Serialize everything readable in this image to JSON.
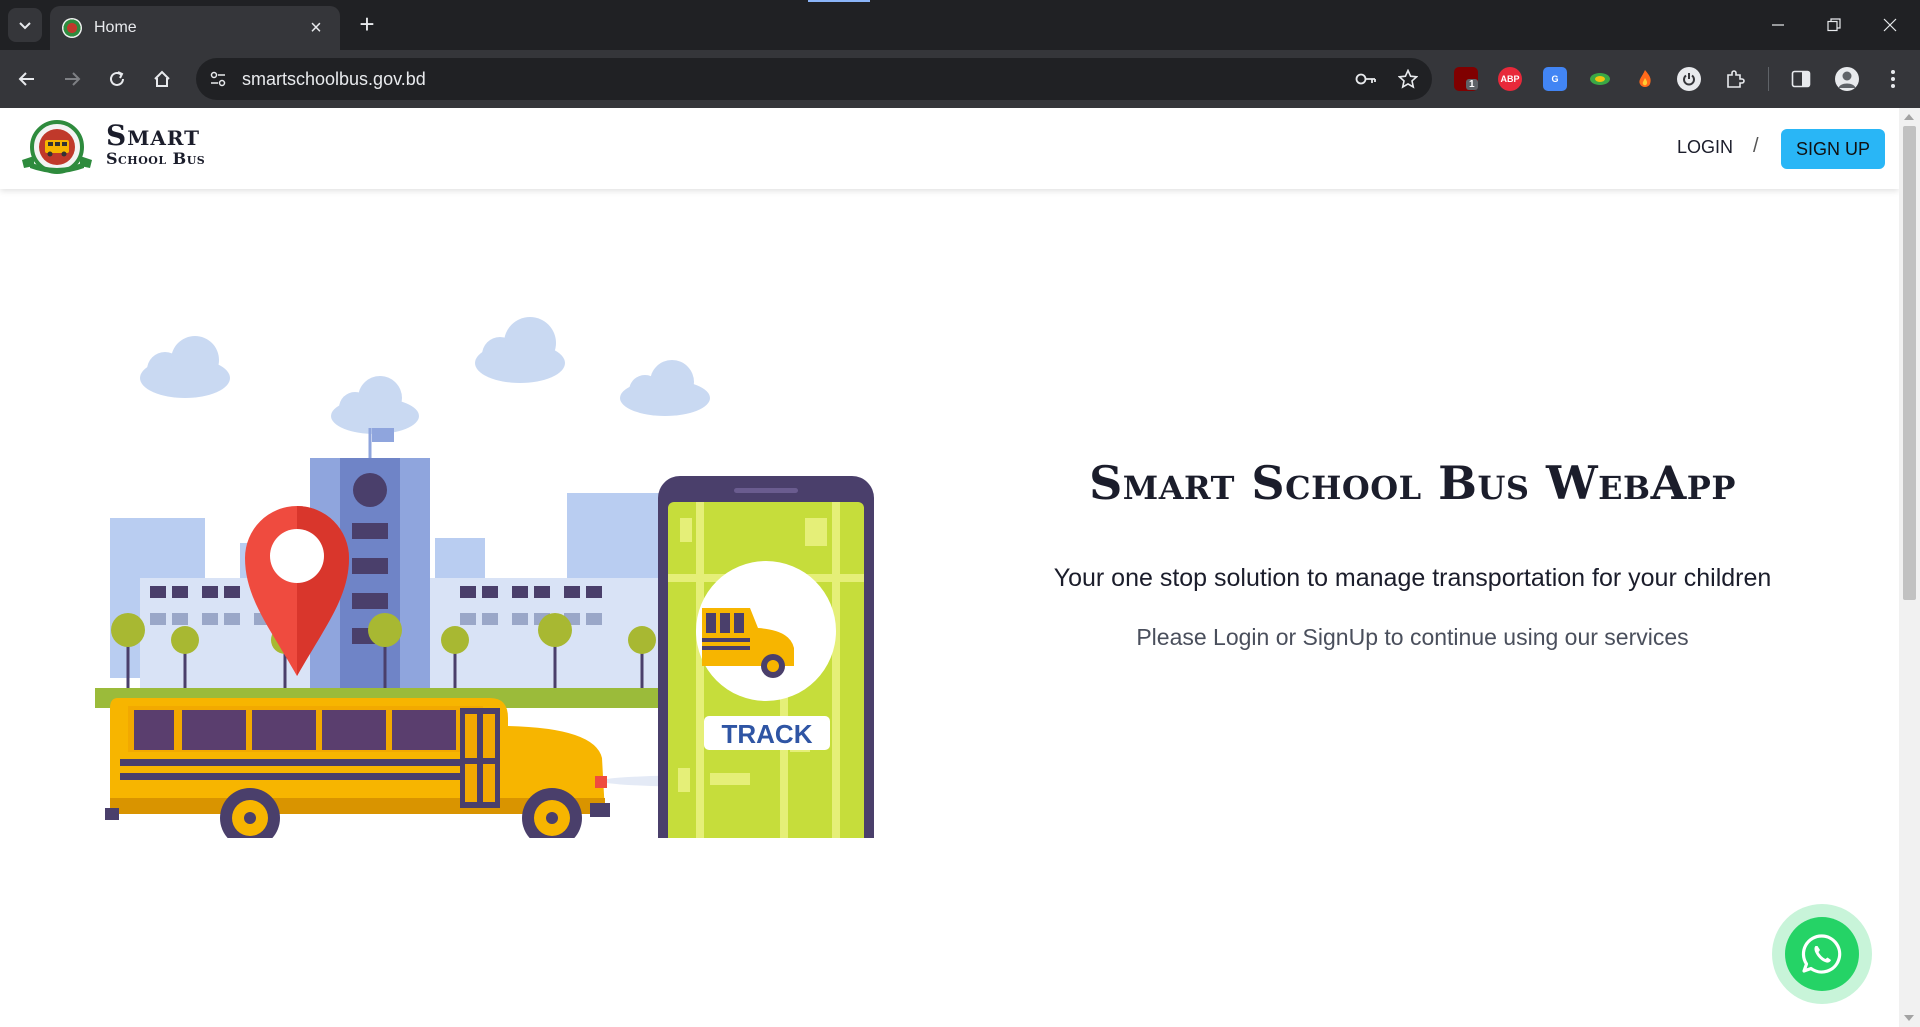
{
  "browser": {
    "tab_title": "Home",
    "url": "smartschoolbus.gov.bd",
    "extension_badge_count": "1",
    "abp_label": "ABP"
  },
  "navbar": {
    "brand_line1": "Smart",
    "brand_line2": "School Bus",
    "login_label": "LOGIN",
    "separator": "/",
    "signup_label": "SIGN UP"
  },
  "hero": {
    "title": "Smart School Bus WebApp",
    "subtitle": "Your one stop solution to manage transportation for your children",
    "note": "Please Login or SignUp to continue using our services",
    "track_label": "TRACK"
  },
  "colors": {
    "accent": "#29b6f6",
    "bus_yellow": "#f7b500",
    "phone_screen": "#c6dd3b",
    "pin_red": "#ef4b3f",
    "whatsapp": "#25d366"
  },
  "icons": {
    "whatsapp": "whatsapp-icon",
    "location": "location-pin-icon"
  }
}
